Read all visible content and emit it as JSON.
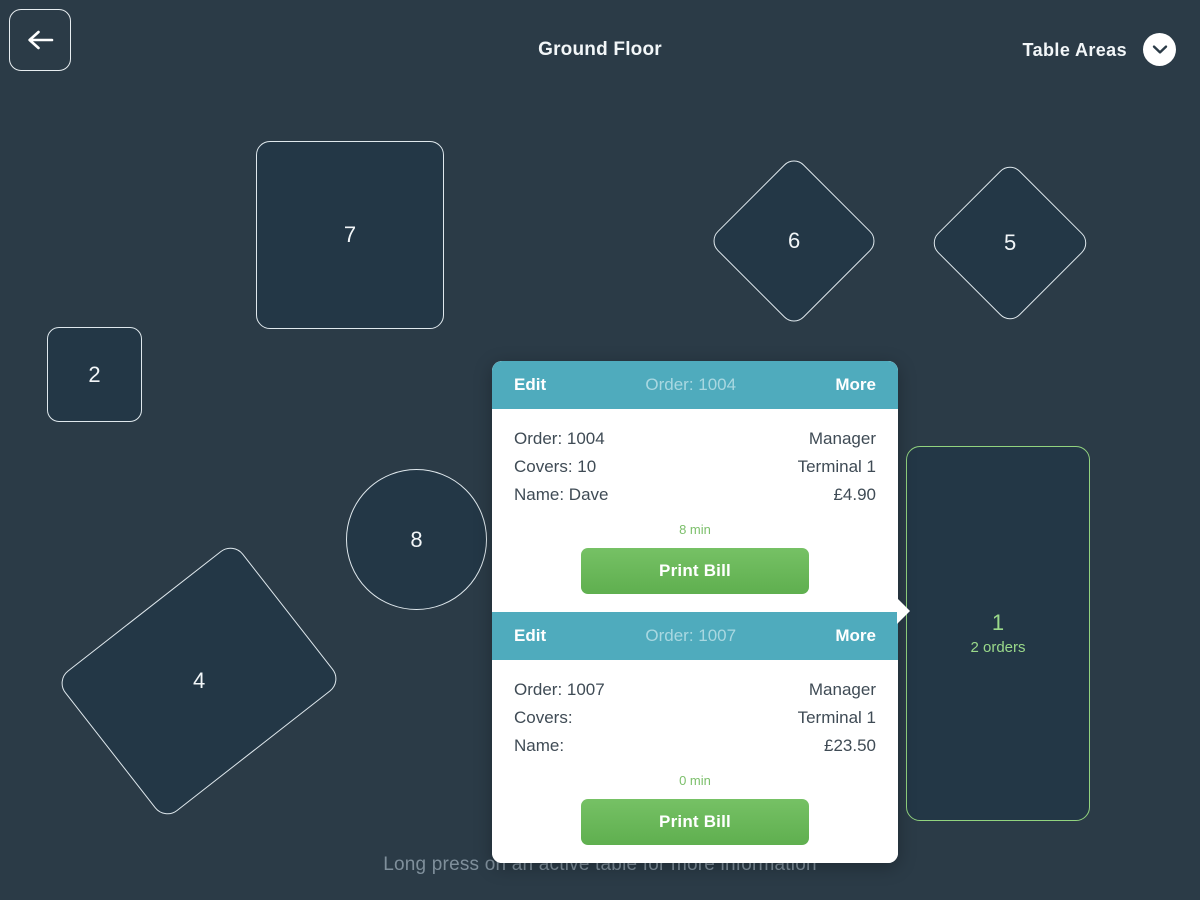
{
  "header": {
    "back_icon": "arrow-left-icon",
    "title": "Ground Floor",
    "areas_label": "Table Areas",
    "areas_chevron_icon": "chevron-down-icon"
  },
  "floor": {
    "hint": "Long press on an active table for more information",
    "tables": [
      {
        "id": "table-7",
        "number": "7",
        "shape": "rounded-square",
        "status": "free",
        "orders_label": ""
      },
      {
        "id": "table-6",
        "number": "6",
        "shape": "diamond",
        "status": "free",
        "orders_label": ""
      },
      {
        "id": "table-5",
        "number": "5",
        "shape": "diamond",
        "status": "free",
        "orders_label": ""
      },
      {
        "id": "table-2",
        "number": "2",
        "shape": "rounded-square",
        "status": "free",
        "orders_label": ""
      },
      {
        "id": "table-8",
        "number": "8",
        "shape": "circle",
        "status": "free",
        "orders_label": ""
      },
      {
        "id": "table-4",
        "number": "4",
        "shape": "rotated-rectangle",
        "status": "free",
        "orders_label": ""
      },
      {
        "id": "table-1",
        "number": "1",
        "shape": "rounded-rectangle",
        "status": "active",
        "orders_label": "2 orders"
      }
    ]
  },
  "popup": {
    "cards": [
      {
        "edit_label": "Edit",
        "order_header": "Order: 1004",
        "more_label": "More",
        "order_line": "Order: 1004",
        "covers_line": "Covers: 10",
        "name_line": "Name: Dave",
        "operator": "Manager",
        "terminal": "Terminal 1",
        "amount": "£4.90",
        "elapsed": "8 min",
        "print_label": "Print Bill"
      },
      {
        "edit_label": "Edit",
        "order_header": "Order: 1007",
        "more_label": "More",
        "order_line": "Order: 1007",
        "covers_line": "Covers:",
        "name_line": "Name:",
        "operator": "Manager",
        "terminal": "Terminal 1",
        "amount": "£23.50",
        "elapsed": "0 min",
        "print_label": "Print Bill"
      }
    ]
  },
  "colors": {
    "background": "#2b3b47",
    "table_fill": "#233746",
    "table_border": "#dfe8ed",
    "accent_teal": "#4fabbd",
    "accent_green": "#6cb85c",
    "active_green": "#92d37f"
  }
}
